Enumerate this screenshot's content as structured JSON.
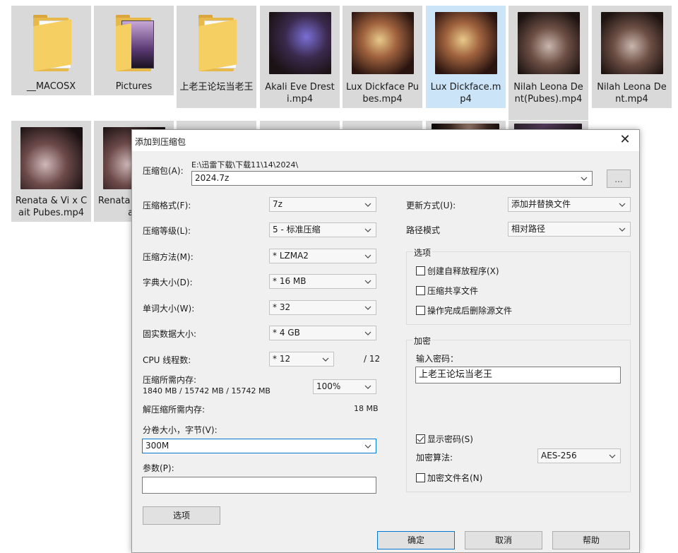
{
  "files": [
    {
      "label": "__MACOSX",
      "kind": "folder"
    },
    {
      "label": "Pictures",
      "kind": "folder-pictures"
    },
    {
      "label": "上老王论坛当老王",
      "kind": "folder"
    },
    {
      "label": "Akali Eve Dresti.mp4",
      "kind": "video"
    },
    {
      "label": "Lux Dickface Pubes.mp4",
      "kind": "video"
    },
    {
      "label": "Lux Dickface.mp4",
      "kind": "video",
      "selected": true
    },
    {
      "label": "Nilah Leona Dent(Pubes).mp4",
      "kind": "video"
    },
    {
      "label": "Nilah Leona Dent.mp4",
      "kind": "video"
    },
    {
      "label": "Renata & Vi x Cait Pubes.mp4",
      "kind": "video"
    },
    {
      "label": "Renata & Vi x Cait",
      "kind": "video"
    }
  ],
  "dialog": {
    "title": "添加到压缩包",
    "archive_label": "压缩包(A):",
    "archive_path": "E:\\迅雷下载\\下载11\\14\\2024\\",
    "archive_name": "2024.7z",
    "browse_label": "...",
    "format_label": "压缩格式(F):",
    "format_value": "7z",
    "level_label": "压缩等级(L):",
    "level_value": "5 - 标准压缩",
    "method_label": "压缩方法(M):",
    "method_value": "* LZMA2",
    "dict_label": "字典大小(D):",
    "dict_value": "* 16 MB",
    "word_label": "单词大小(W):",
    "word_value": "* 32",
    "solid_label": "固实数据大小:",
    "solid_value": "* 4 GB",
    "threads_label": "CPU 线程数:",
    "threads_value": "* 12",
    "threads_max": "/ 12",
    "mem_label": "压缩所需内存:",
    "mem_value": "1840 MB / 15742 MB / 15742 MB",
    "mem_percent": "100%",
    "decomp_label": "解压缩所需内存:",
    "decomp_value": "18 MB",
    "volume_label": "分卷大小，字节(V):",
    "volume_value": "300M",
    "params_label": "参数(P):",
    "params_value": "",
    "options_button": "选项",
    "update_label": "更新方式(U):",
    "update_value": "添加并替换文件",
    "path_label": "路径模式",
    "path_value": "相对路径",
    "options_group": "选项",
    "opt_sfx": "创建自释放程序(X)",
    "opt_shared": "压缩共享文件",
    "opt_delete": "操作完成后删除源文件",
    "enc_group": "加密",
    "pwd_label": "输入密码：",
    "pwd_value": "上老王论坛当老王",
    "show_pwd": "显示密码(S)",
    "algo_label": "加密算法:",
    "algo_value": "AES-256",
    "enc_names": "加密文件名(N)",
    "ok_button": "确定",
    "cancel_button": "取消",
    "help_button": "帮助"
  }
}
